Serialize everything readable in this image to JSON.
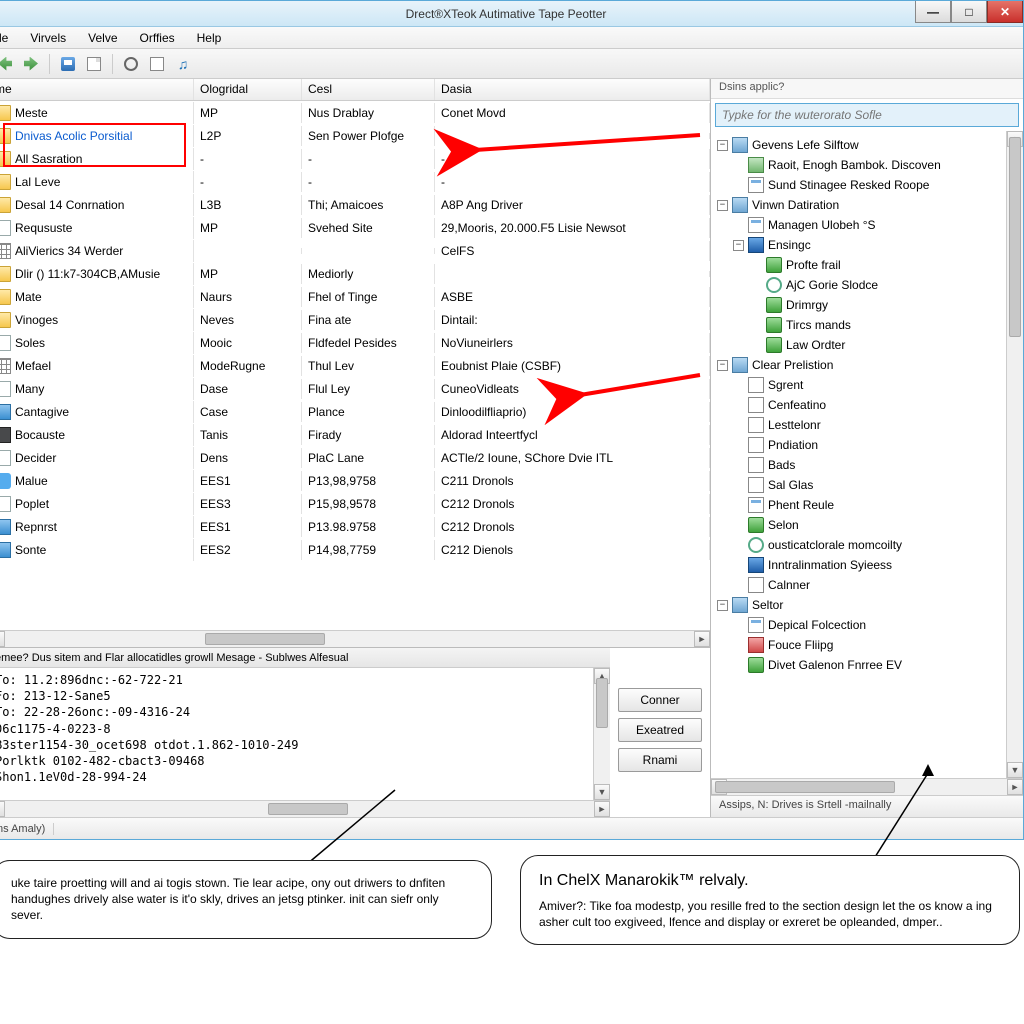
{
  "window": {
    "title": "Drect®XTeok Autimative Tape Peotter"
  },
  "menubar": [
    "le",
    "Virvels",
    "Velve",
    "Orffies",
    "Help"
  ],
  "columns": [
    "me",
    "Ologridal",
    "Cesl",
    "Dasia"
  ],
  "rows": [
    {
      "icon": "folder",
      "name": "Meste",
      "c2": "MP",
      "c3": "Nus Drablay",
      "c4": "Conet Movd"
    },
    {
      "icon": "folder",
      "name": "Dnivas Acolic Porsitial",
      "c2": "L2P",
      "c3": "Sen Power Plofge",
      "c4": "",
      "sel": true
    },
    {
      "icon": "folder",
      "name": "All Sasration",
      "c2": "-",
      "c3": "-",
      "c4": "-"
    },
    {
      "icon": "folder",
      "name": "Lal Leve",
      "c2": "-",
      "c3": "-",
      "c4": "-"
    },
    {
      "icon": "folder",
      "name": "Desal 14 Conrnation",
      "c2": "L3B",
      "c3": "Thi; Amaicoes",
      "c4": "A8P Ang Driver"
    },
    {
      "icon": "file",
      "name": "Reqususte",
      "c2": "MP",
      "c3": "Svehed Site",
      "c4": "29,Mooris, 20.000.F5 Lisie Newsot"
    },
    {
      "icon": "grid",
      "name": "AliVierics 34 Werder",
      "c2": "",
      "c3": "",
      "c4": "CelFS"
    },
    {
      "icon": "folder",
      "name": "Dlir () 11:k7-304CB,AMusie",
      "c2": "MP",
      "c3": "Mediorly",
      "c4": ""
    },
    {
      "icon": "folder",
      "name": "Mate",
      "c2": "Naurs",
      "c3": "Fhel of Tinge",
      "c4": "ASBE"
    },
    {
      "icon": "folder",
      "name": "Vinoges",
      "c2": "Neves",
      "c3": "Fina ate",
      "c4": "Dintail:"
    },
    {
      "icon": "file",
      "name": "Soles",
      "c2": "Mooic",
      "c3": "Fldfedel Pesides",
      "c4": "NoViuneirlers"
    },
    {
      "icon": "grid",
      "name": "Mefael",
      "c2": "ModeRugne",
      "c3": "Thul Lev",
      "c4": "Eoubnist Plaie (CSBF)"
    },
    {
      "icon": "file",
      "name": "Many",
      "c2": "Dase",
      "c3": "Flul Ley",
      "c4": "CuneoVidleats"
    },
    {
      "icon": "blue",
      "name": "Cantagive",
      "c2": "Case",
      "c3": "Plance",
      "c4": "Dinloodilfliaprio)"
    },
    {
      "icon": "dark",
      "name": "Bocauste",
      "c2": "Tanis",
      "c3": "Firady",
      "c4": "Aldorad Inteertfycl"
    },
    {
      "icon": "file",
      "name": "Decider",
      "c2": "Dens",
      "c3": "PlaC Lane",
      "c4": "ACTle/2 Ioune, SChore Dvie ITL"
    },
    {
      "icon": "tw",
      "name": "Malue",
      "c2": "EES1",
      "c3": "P13,98,9758",
      "c4": "C211 Dronols"
    },
    {
      "icon": "file",
      "name": "Poplet",
      "c2": "EES3",
      "c3": "P15,98,9578",
      "c4": "C212 Dronols"
    },
    {
      "icon": "blue",
      "name": "Repnrst",
      "c2": "EES1",
      "c3": "P13.98.9758",
      "c4": "C212 Dronols"
    },
    {
      "icon": "blue",
      "name": "Sonte",
      "c2": "EES2",
      "c3": "P14,98,7759",
      "c4": "C212 Dienols"
    }
  ],
  "log": {
    "title": "emee? Dus sitem and Flar allocatidles growll Mesage - Sublwes Alfesual",
    "lines": "To: 11.2:896dnc:-62-722-21\nFo: 213-12-Sane5\nTo: 22-28-26onc:-09-4316-24\n06c1175-4-0223-8\nB3ster1154-30_ocet698 otdot.1.862-1010-249\nPorlktk 0102-482-cbact3-09468\nShon1.1eV0d-28-994-24"
  },
  "buttons": {
    "b1": "Conner",
    "b2": "Exeatred",
    "b3": "Rnami"
  },
  "status": {
    "left": "ns Amaly)",
    "right": "Assips, N: Drives is Srtell -mailnally"
  },
  "side": {
    "header": "Dsins applic?",
    "search_placeholder": "Typke for the wuterorato Sofle",
    "nodes": [
      {
        "d": 0,
        "exp": "-",
        "ic": "mon",
        "t": "Gevens Lefe Silftow"
      },
      {
        "d": 1,
        "exp": "",
        "ic": "img",
        "t": "Raoit, Enogh Bambok. Discoven"
      },
      {
        "d": 1,
        "exp": "",
        "ic": "pg",
        "t": "Sund Stinagee Resked Roope"
      },
      {
        "d": 0,
        "exp": "-",
        "ic": "mon",
        "t": "Vinwn Datiration"
      },
      {
        "d": 1,
        "exp": "",
        "ic": "pg",
        "t": "Managen Ulobeh °S"
      },
      {
        "d": 1,
        "exp": "-",
        "ic": "blue",
        "t": "Ensingc"
      },
      {
        "d": 2,
        "exp": "",
        "ic": "g",
        "t": "Profte frail"
      },
      {
        "d": 2,
        "exp": "",
        "ic": "gear",
        "t": "AjC Gorie Slodce"
      },
      {
        "d": 2,
        "exp": "",
        "ic": "g",
        "t": "Drimrgy"
      },
      {
        "d": 2,
        "exp": "",
        "ic": "g",
        "t": "Tircs mands"
      },
      {
        "d": 2,
        "exp": "",
        "ic": "g",
        "t": "Law Ordter"
      },
      {
        "d": 0,
        "exp": "-",
        "ic": "mon",
        "t": "Clear Prelistion"
      },
      {
        "d": 1,
        "exp": "",
        "ic": "doc",
        "t": "Sgrent"
      },
      {
        "d": 1,
        "exp": "",
        "ic": "doc",
        "t": "Cenfeatino"
      },
      {
        "d": 1,
        "exp": "",
        "ic": "doc",
        "t": "Lesttelonr"
      },
      {
        "d": 1,
        "exp": "",
        "ic": "doc",
        "t": "Pndiation"
      },
      {
        "d": 1,
        "exp": "",
        "ic": "doc",
        "t": "Bads"
      },
      {
        "d": 1,
        "exp": "",
        "ic": "doc",
        "t": "Sal Glas"
      },
      {
        "d": 1,
        "exp": "",
        "ic": "pg",
        "t": "Phent Reule"
      },
      {
        "d": 1,
        "exp": "",
        "ic": "g",
        "t": "Selon"
      },
      {
        "d": 1,
        "exp": "",
        "ic": "gear",
        "t": "ousticatclorale momcoilty"
      },
      {
        "d": 1,
        "exp": "",
        "ic": "blue",
        "t": "Inntralinmation Syieess"
      },
      {
        "d": 1,
        "exp": "",
        "ic": "doc",
        "t": "Calnner"
      },
      {
        "d": 0,
        "exp": "-",
        "ic": "mon",
        "t": "Seltor"
      },
      {
        "d": 1,
        "exp": "",
        "ic": "pg",
        "t": "Depical Folcection"
      },
      {
        "d": 1,
        "exp": "",
        "ic": "red",
        "t": "Fouce Fliipg"
      },
      {
        "d": 1,
        "exp": "",
        "ic": "g",
        "t": "Divet Galenon Fnrree EV"
      }
    ]
  },
  "callouts": {
    "left": "uke taire proetting will and ai togis stown.  Tie lear acipe, ony out driwers to dnfiten handughes drively alse water is it'o skly, drives an jetsg ptinker. init can siefr only sever.",
    "right_title": "In ChelX Manarokik™ relvaly.",
    "right_body": "Amiver?:  Tike foa modestp, you resille fred to the section design let the os know a ing asher cult too exgiveed, lfence and display or exreret be opleanded, dmper.."
  }
}
